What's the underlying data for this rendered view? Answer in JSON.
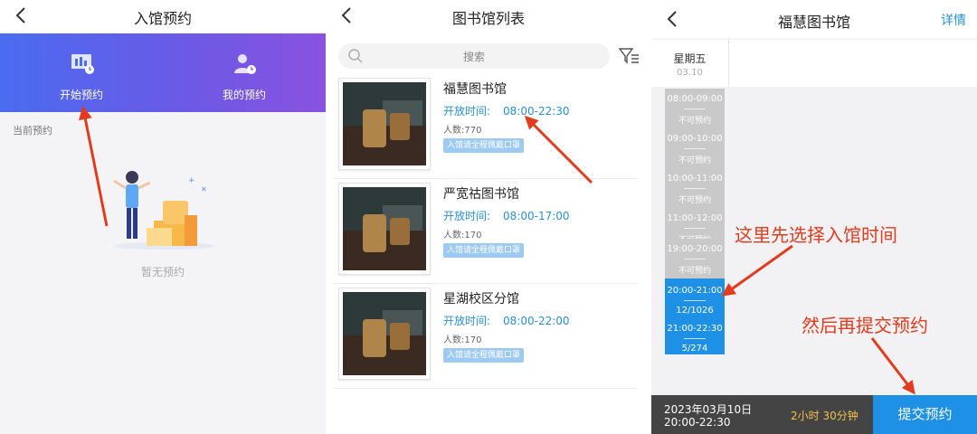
{
  "colors": {
    "accent": "#1e90e6",
    "banner_start": "#4a6cf0",
    "banner_end": "#8a52e0",
    "annotation": "#e23b1e",
    "duration": "#f5c24a"
  },
  "screen1": {
    "title": "入馆预约",
    "tools": [
      {
        "label": "开始预约",
        "icon": "calendar-board-icon"
      },
      {
        "label": "我的预约",
        "icon": "user-clock-icon"
      }
    ],
    "section_label": "当前预约",
    "empty_text": "暂无预约"
  },
  "screen2": {
    "title": "图书馆列表",
    "search_placeholder": "搜索",
    "hours_label": "开放时间:",
    "libraries": [
      {
        "name": "福慧图书馆",
        "hours": "08:00-22:30",
        "count": "人数:770",
        "tag": "入馆请全程佩戴口罩"
      },
      {
        "name": "严宽祜图书馆",
        "hours": "08:00-17:00",
        "count": "人数:170",
        "tag": "入馆请全程佩戴口罩"
      },
      {
        "name": "星湖校区分馆",
        "hours": "08:00-22:00",
        "count": "人数:170",
        "tag": "入馆请全程佩戴口罩"
      }
    ]
  },
  "screen3": {
    "title": "福慧图书馆",
    "detail_link": "详情",
    "day": {
      "name": "星期五",
      "date": "03.10"
    },
    "slots": [
      {
        "time": "08:00-09:00",
        "status": "不可预约",
        "available": false
      },
      {
        "time": "09:00-10:00",
        "status": "不可预约",
        "available": false
      },
      {
        "time": "10:00-11:00",
        "status": "不可预约",
        "available": false
      },
      {
        "time": "11:00-12:00",
        "status": "不可预约",
        "available": false
      },
      {
        "time": "19:00-20:00",
        "status": "不可预约",
        "available": false
      },
      {
        "time": "20:00-21:00",
        "status": "12/1026",
        "available": true
      },
      {
        "time": "21:00-22:30",
        "status": "5/274",
        "available": true
      }
    ],
    "footer": {
      "date": "2023年03月10日",
      "time": "20:00-22:30",
      "duration": "2小时 30分钟",
      "submit": "提交预约"
    }
  },
  "annotations": {
    "step1": "这里先选择入馆时间",
    "step2": "然后再提交预约"
  }
}
